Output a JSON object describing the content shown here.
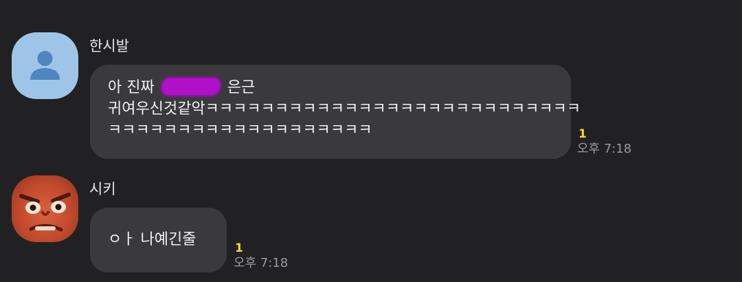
{
  "messages": [
    {
      "sender": "한시발",
      "avatar_icon": "default-person-icon",
      "avatar_color": "#9ec5e8",
      "text_before_redaction": "아 진짜",
      "redaction_color": "#b010c8",
      "text_after_redaction": "은근",
      "line2": "귀여우신것같악ㅋㅋㅋㅋㅋㅋㅋㅋㅋㅋㅋㅋㅋㅋㅋㅋㅋㅋㅋㅋㅋㅋㅋㅋㅋㅋㅋ",
      "line3": "ㅋㅋㅋㅋㅋㅋㅋㅋㅋㅋㅋㅋㅋㅋㅋㅋㅋㅋㅋ",
      "unread_count": "1",
      "time": "오후 7:18"
    },
    {
      "sender": "시키",
      "avatar_icon": "angry-face-icon",
      "text": "ㅇㅏ 나예긴줄",
      "unread_count": "1",
      "time": "오후 7:18"
    }
  ],
  "colors": {
    "background": "#212123",
    "bubble": "#3a3a3c",
    "unread": "#f3dc2b",
    "time": "#9a9a9f"
  }
}
